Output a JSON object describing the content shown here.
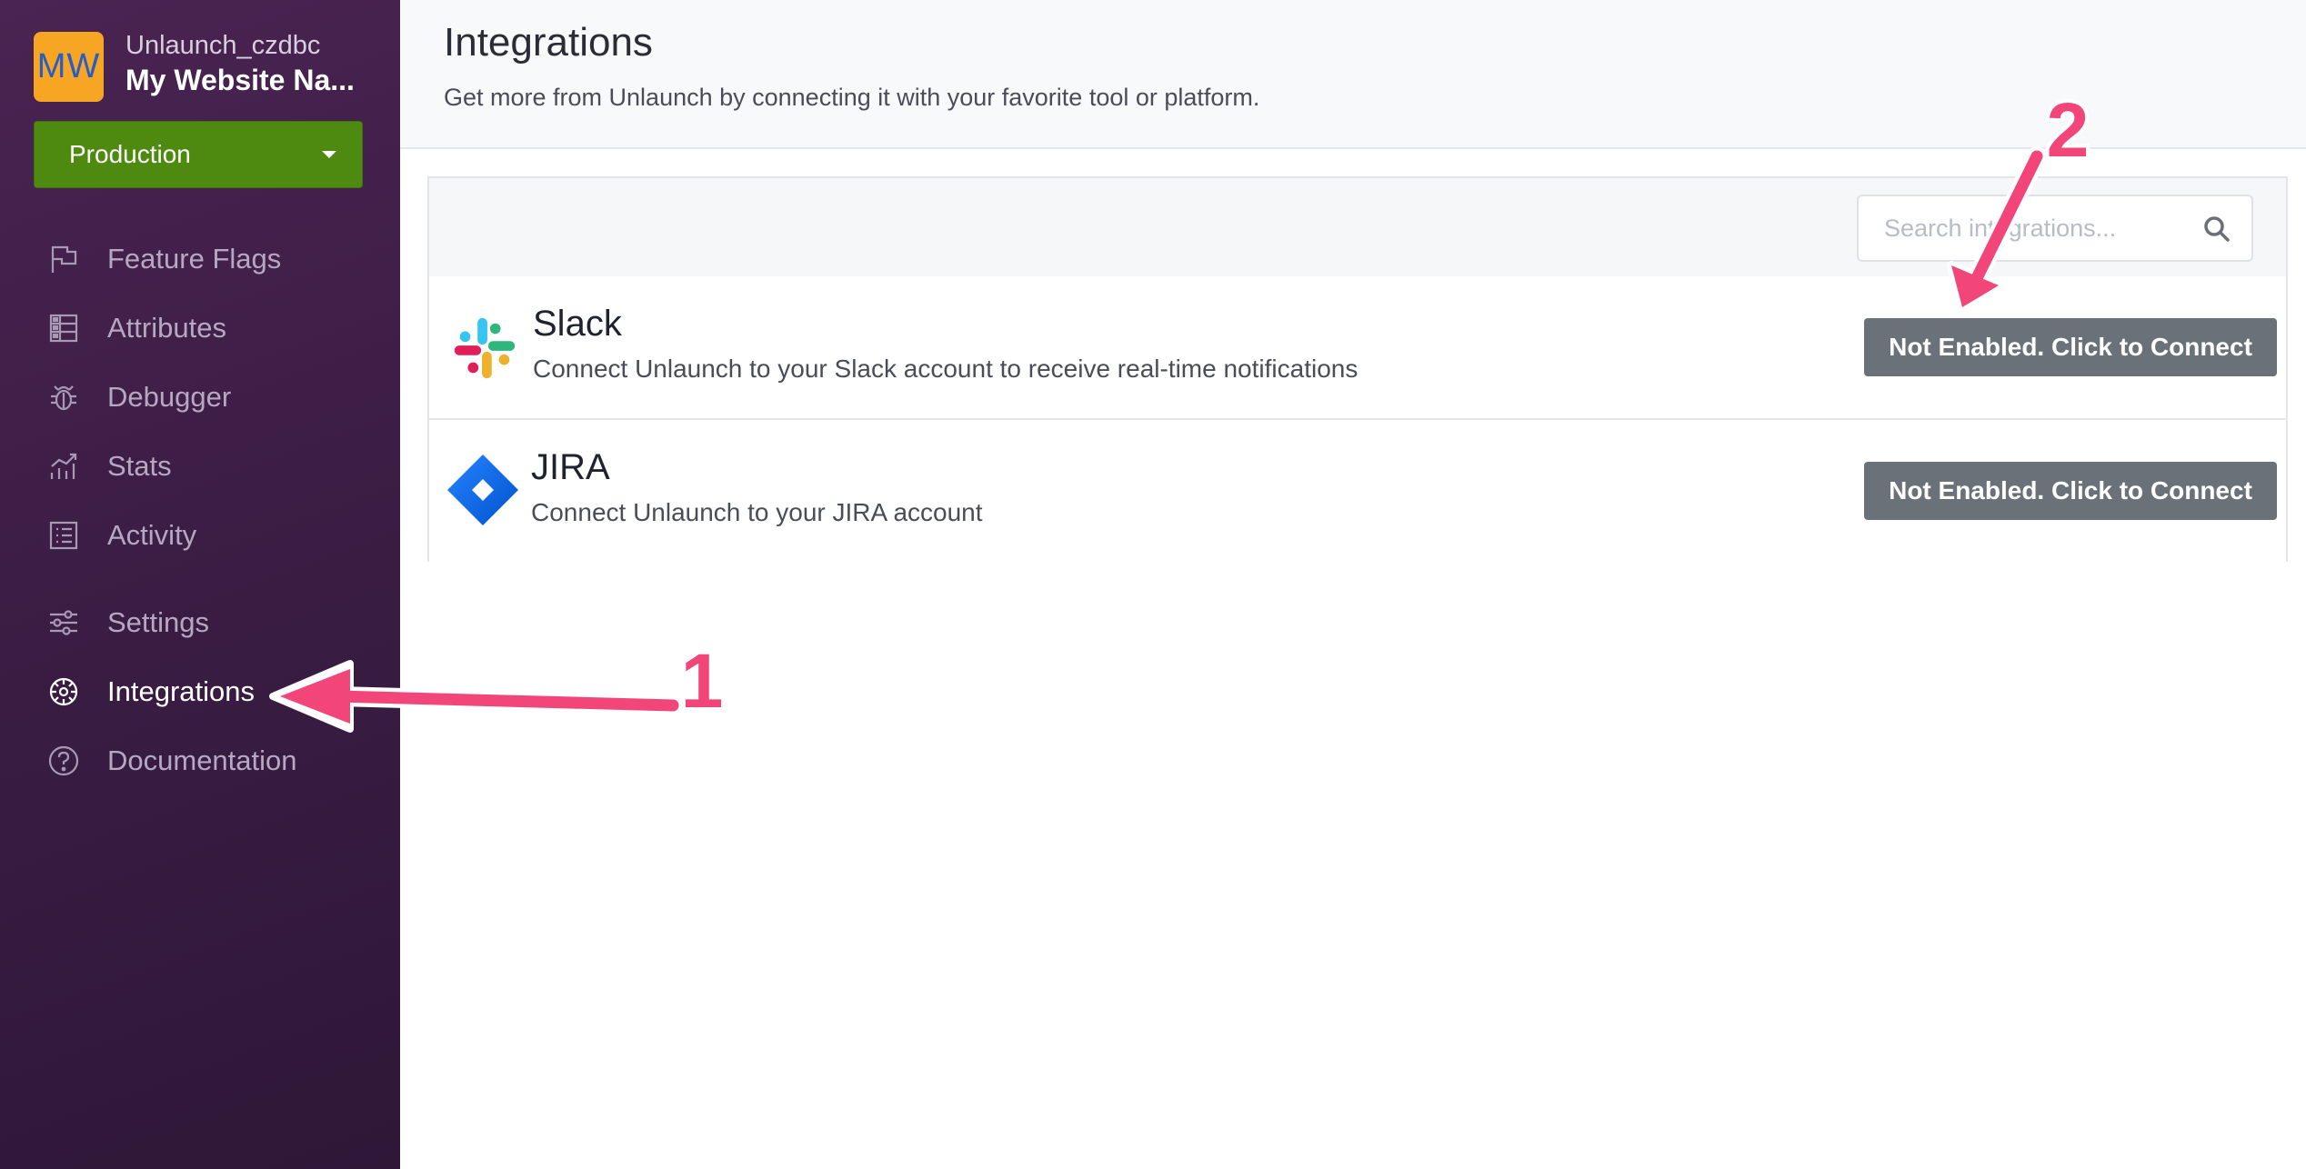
{
  "sidebar": {
    "logo_initials": "MW",
    "org_name": "Unlaunch_czdbc",
    "site_name": "My Website Na...",
    "environment": "Production",
    "items": [
      {
        "label": "Feature Flags",
        "icon": "flag-icon"
      },
      {
        "label": "Attributes",
        "icon": "attributes-icon"
      },
      {
        "label": "Debugger",
        "icon": "bug-icon"
      },
      {
        "label": "Stats",
        "icon": "chart-icon"
      },
      {
        "label": "Activity",
        "icon": "list-icon"
      },
      {
        "label": "Settings",
        "icon": "sliders-icon"
      },
      {
        "label": "Integrations",
        "icon": "integrations-icon",
        "active": true
      },
      {
        "label": "Documentation",
        "icon": "help-icon"
      }
    ]
  },
  "header": {
    "title": "Integrations",
    "subtitle": "Get more from Unlaunch by connecting it with your favorite tool or platform."
  },
  "search": {
    "placeholder": "Search integrations..."
  },
  "integrations": [
    {
      "name": "Slack",
      "description": "Connect Unlaunch to your Slack account to receive real-time notifications",
      "button_label": "Not Enabled. Click to Connect",
      "icon": "slack-logo-icon"
    },
    {
      "name": "JIRA",
      "description": "Connect Unlaunch to your JIRA account",
      "button_label": "Not Enabled. Click to Connect",
      "icon": "jira-logo-icon"
    }
  ],
  "annotations": {
    "step1": "1",
    "step2": "2"
  },
  "colors": {
    "sidebar_bg": "#3c1d45",
    "env_green": "#4f8a10",
    "logo_orange": "#f6a623",
    "button_gray": "#6b7178",
    "annotation_pink": "#f2457a"
  }
}
